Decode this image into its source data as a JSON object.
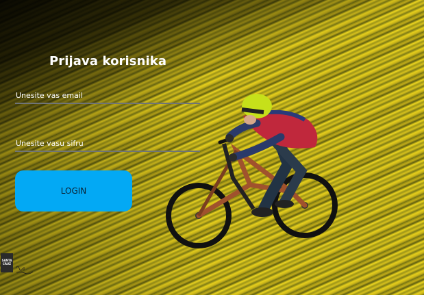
{
  "form": {
    "title": "Prijava korisnika",
    "email_placeholder": "Unesite vas email",
    "email_value": "",
    "password_placeholder": "Unesite vasu sifru",
    "password_value": "",
    "login_label": "LOGIN"
  },
  "logo": {
    "text": "SANTA CRUZ",
    "icon": "brand-logo"
  },
  "colors": {
    "accent": "#03a9f4",
    "title_text": "#ffffff",
    "field_underline": "#6f7478",
    "background_yellow": "#e6cf1c"
  }
}
